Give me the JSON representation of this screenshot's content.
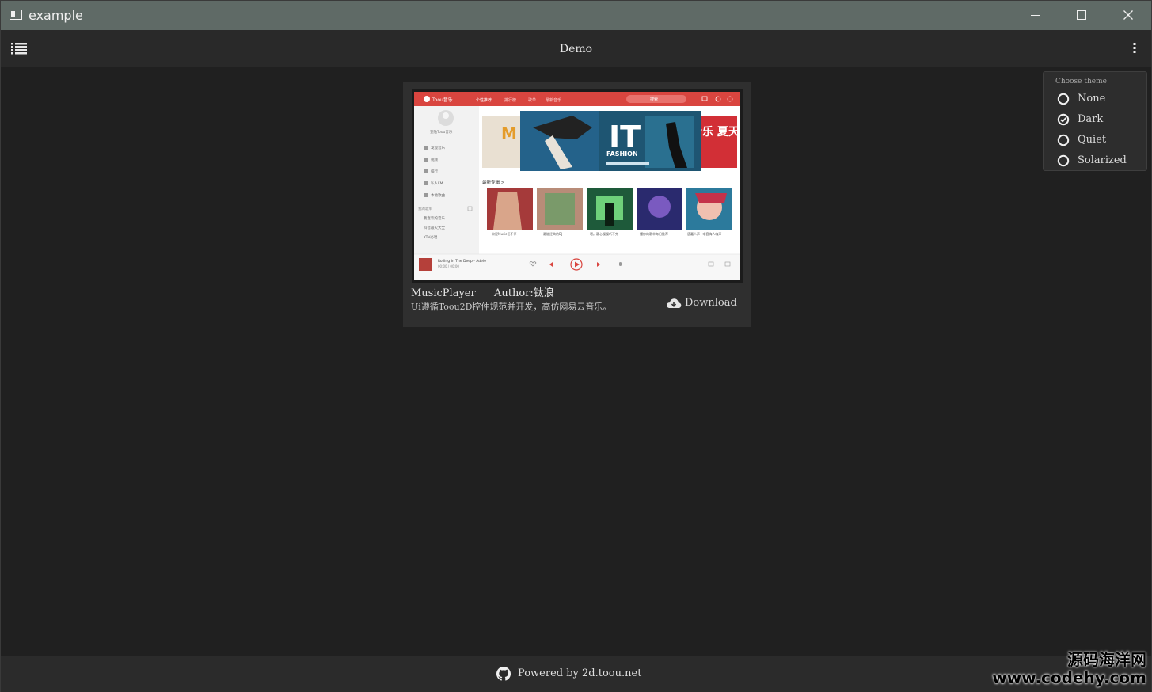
{
  "window": {
    "title": "example"
  },
  "appbar": {
    "title": "Demo"
  },
  "card": {
    "name": "MusicPlayer",
    "author": "Author:钛浪",
    "description": "Ui遵循Toou2D控件规范并开发，高仿网易云音乐。",
    "download_label": "Download",
    "screenshot": {
      "brand": "Toou音乐",
      "nav": [
        "个性推荐",
        "排行榜",
        "歌单",
        "最新音乐"
      ],
      "search_placeholder": "搜索",
      "sidebar_user": "登陆Toou音乐",
      "sidebar_items": [
        "发现音乐",
        "视频",
        "排行",
        "私人FM",
        "本地歌曲"
      ],
      "sidebar_section": "我的歌单",
      "sidebar_playlists": [
        "我喜欢的音乐",
        "抖音最火大全",
        "KTV必唱"
      ],
      "banner_big": "IT",
      "banner_sub": "FASHION",
      "banner_left": "M 音乐",
      "banner_right": "音乐 夏天",
      "section_title": "最新专辑 >",
      "albums": [
        "宋星Music巨不停",
        "最能经典的DJ",
        "嗯。静心慢慢听不完",
        "懂你的歌单每日推荐",
        "唐嘉人声+电音嗨人嗨声"
      ],
      "now_playing": "Rolling In The Deep - Adele",
      "time": "00:00 / 00:00",
      "colors": {
        "brand_red": "#e04848",
        "sidebar": "#f2f2f2"
      }
    }
  },
  "theme_menu": {
    "title": "Choose theme",
    "options": [
      {
        "label": "None",
        "selected": false
      },
      {
        "label": "Dark",
        "selected": true
      },
      {
        "label": "Quiet",
        "selected": false
      },
      {
        "label": "Solarized",
        "selected": false
      }
    ]
  },
  "footer": {
    "powered": "Powered by 2d.toou.net",
    "icon": "github-icon"
  },
  "watermark": {
    "cn": "源码海洋网",
    "url": "www.codehy.com"
  }
}
